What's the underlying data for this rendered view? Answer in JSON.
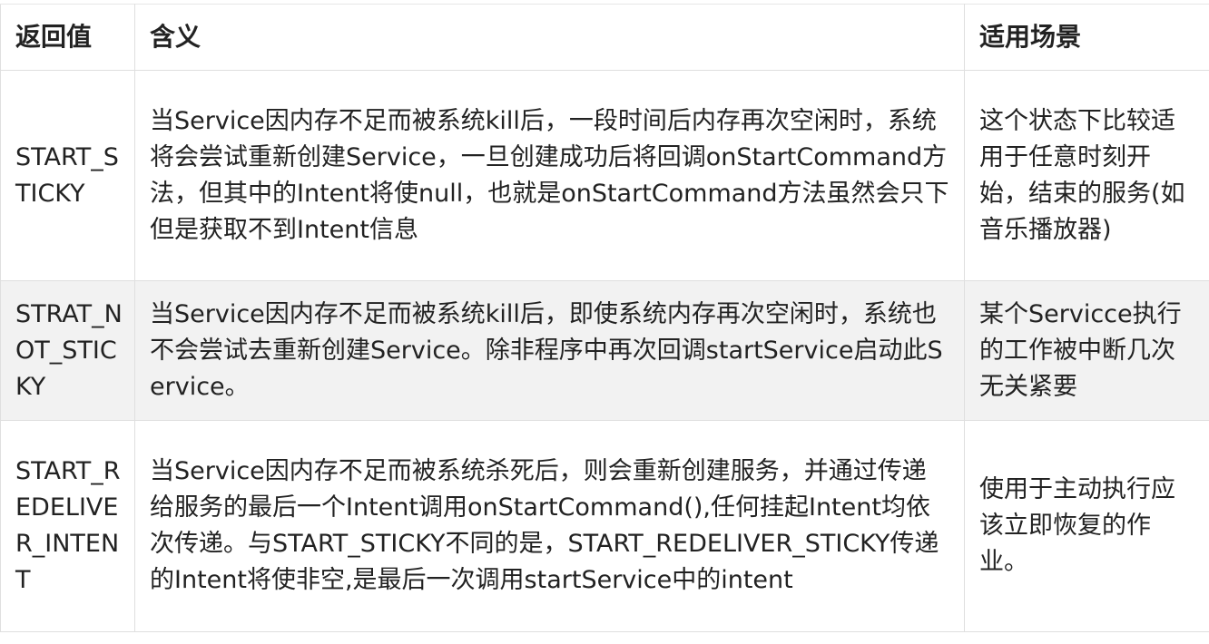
{
  "table": {
    "headers": [
      "返回值",
      "含义",
      "适用场景"
    ],
    "rows": [
      {
        "value": "START_STICKY",
        "meaning": "当Service因内存不足而被系统kill后，一段时间后内存再次空闲时，系统将会尝试重新创建Service，一旦创建成功后将回调onStartCommand方法，但其中的Intent将使null，也就是onStartCommand方法虽然会只下但是获取不到Intent信息",
        "scenario": "这个状态下比较适用于任意时刻开始，结束的服务(如音乐播放器)"
      },
      {
        "value": "STRAT_NOT_STICKY",
        "meaning": "当Service因内存不足而被系统kill后，即使系统内存再次空闲时，系统也不会尝试去重新创建Service。除非程序中再次回调startService启动此Service。",
        "scenario": "某个Servicce执行的工作被中断几次无关紧要"
      },
      {
        "value": "START_REDELIVER_INTENT",
        "meaning": "当Service因内存不足而被系统杀死后，则会重新创建服务，并通过传递给服务的最后一个Intent调用onStartCommand(),任何挂起Intent均依次传递。与START_STICKY不同的是，START_REDELIVER_STICKY传递的Intent将使非空,是最后一次调用startService中的intent",
        "scenario": "使用于主动执行应该立即恢复的作业。"
      }
    ]
  }
}
